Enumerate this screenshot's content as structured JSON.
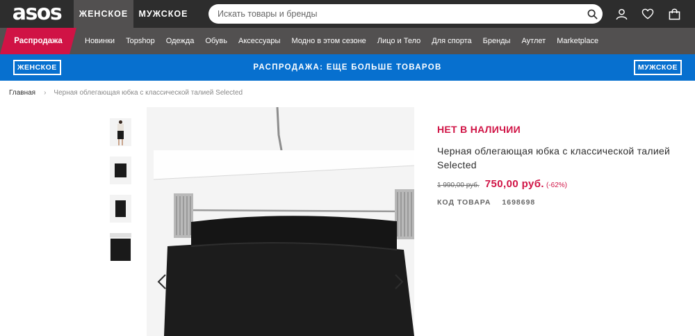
{
  "header": {
    "logo": "asos",
    "tabs": [
      "ЖЕНСКОЕ",
      "МУЖСКОЕ"
    ],
    "search_placeholder": "Искать товары и бренды"
  },
  "nav": {
    "sale": "Распродажа",
    "items": [
      "Новинки",
      "Topshop",
      "Одежда",
      "Обувь",
      "Аксессуары",
      "Модно в этом сезоне",
      "Лицо и Тело",
      "Для спорта",
      "Бренды",
      "Аутлет",
      "Marketplace"
    ]
  },
  "promo": {
    "left": "ЖЕНСКОЕ",
    "text": "РАСПРОДАЖА: ЕЩЕ БОЛЬШЕ ТОВАРОВ",
    "right": "МУЖСКОЕ"
  },
  "breadcrumb": {
    "home": "Главная",
    "sep": "›",
    "current": "Черная облегающая юбка с классической талией Selected"
  },
  "product": {
    "status": "НЕТ В НАЛИЧИИ",
    "title": "Черная облегающая юбка с классической талией Selected",
    "old_price": "1 990,00 руб.",
    "new_price": "750,00 руб.",
    "discount": "(-62%)",
    "code_label": "КОД ТОВАРА",
    "code_value": "1698698"
  },
  "colors": {
    "header_dark": "#2d2d2d",
    "nav_gray": "#525050",
    "sale_red": "#d01345",
    "promo_blue": "#0770cf"
  }
}
